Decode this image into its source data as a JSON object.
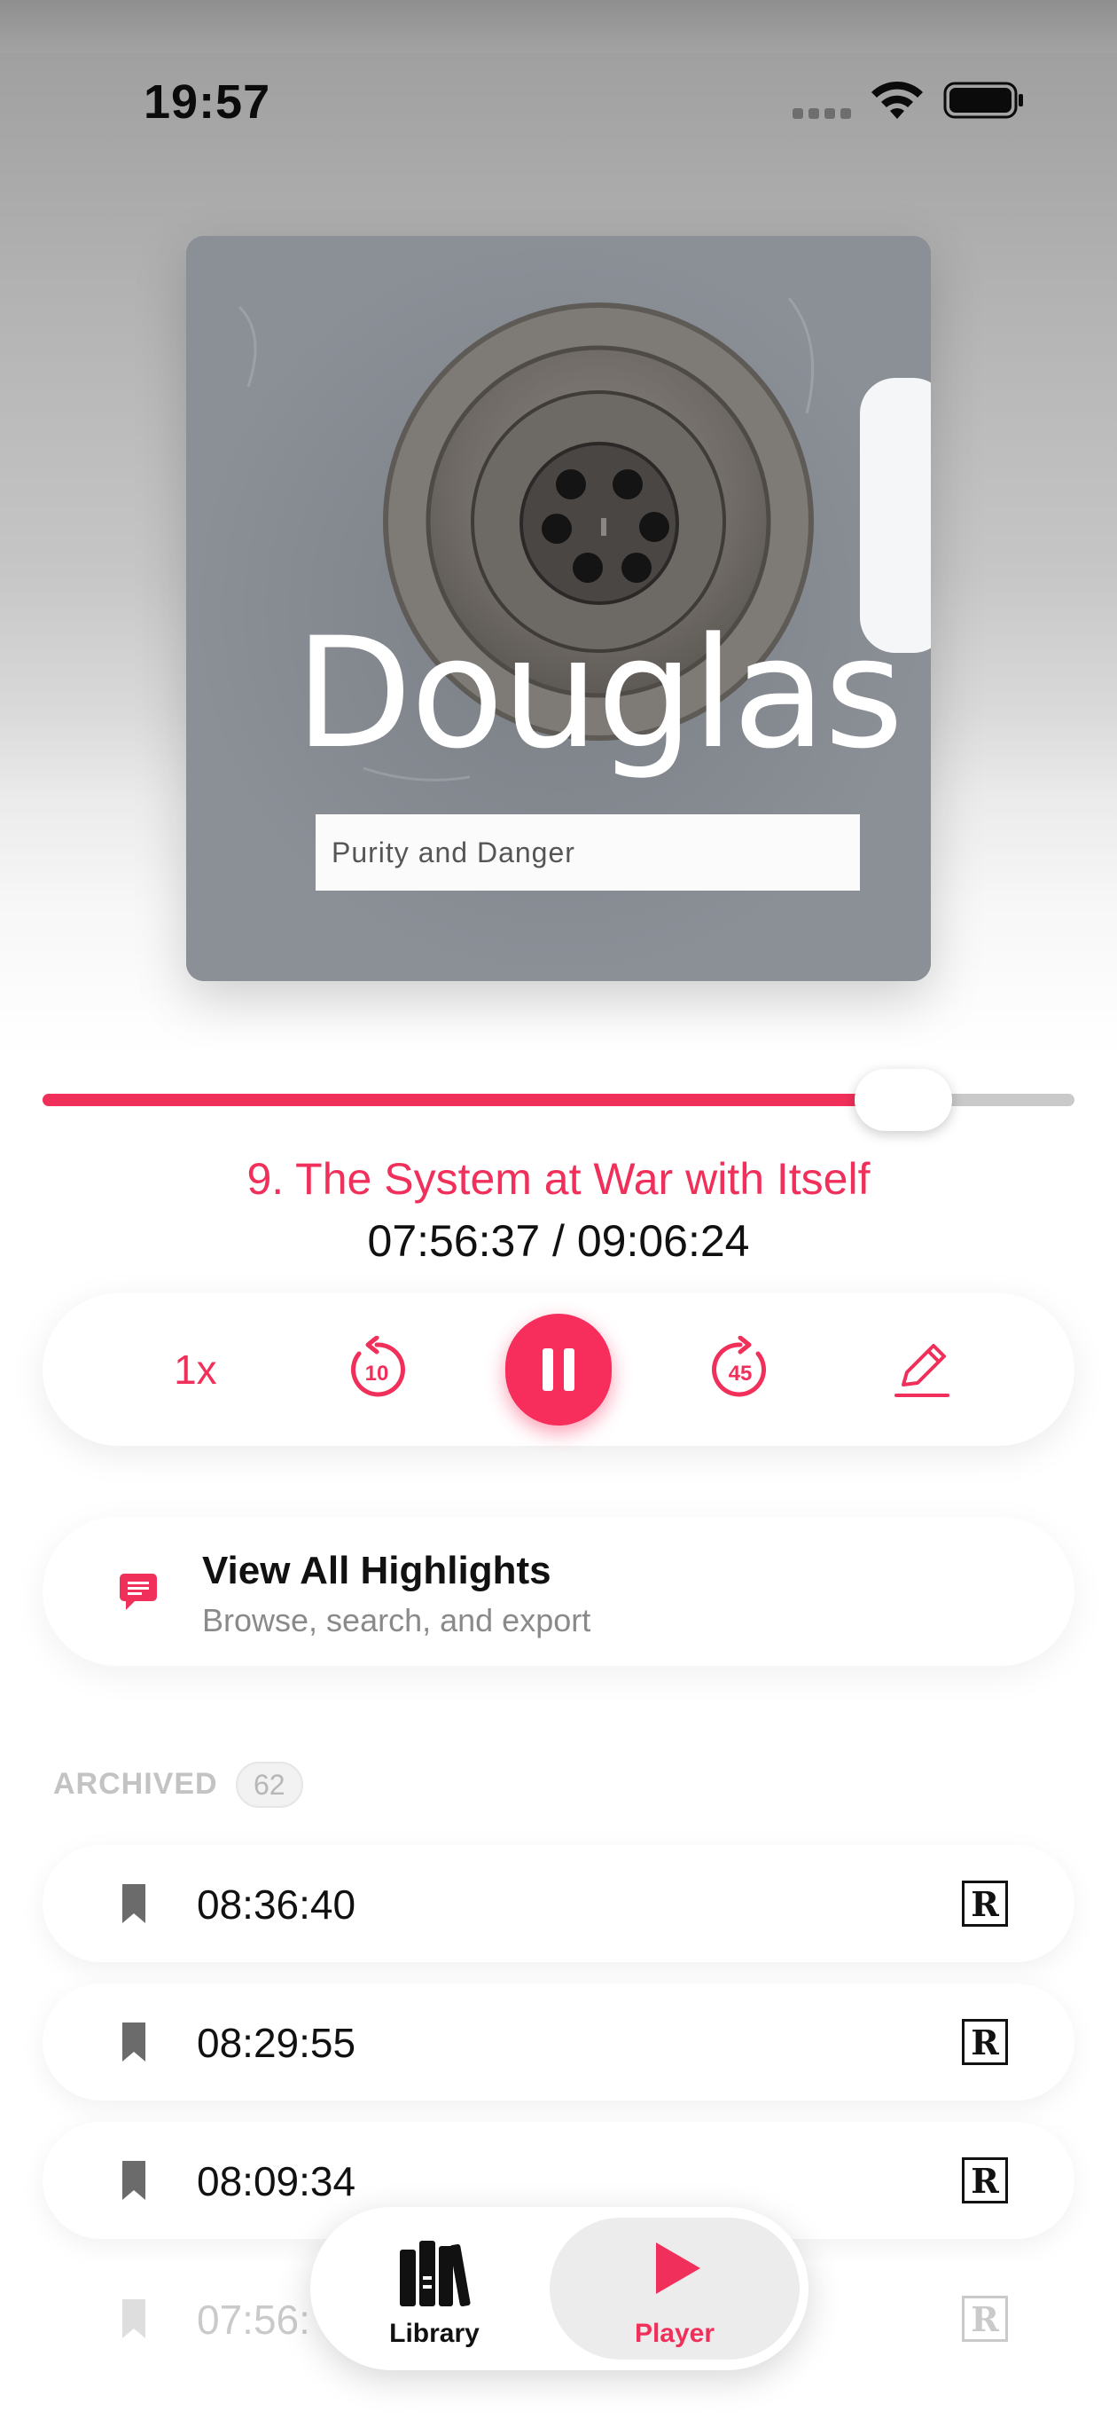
{
  "status_bar": {
    "time": "19:57"
  },
  "album": {
    "cover_author": "Douglas",
    "cover_subtitle": "Purity and Danger"
  },
  "playback": {
    "progress_fraction": 0.834,
    "chapter_title": "9. The System at War with Itself",
    "time_readout": "07:56:37 / 09:06:24",
    "accent_color": "#f0305a"
  },
  "controls": {
    "speed_label": "1x",
    "rewind_icon": "rewind-10-icon",
    "rewind_seconds": "10",
    "play_pause_icon": "pause-icon",
    "forward_icon": "forward-45-icon",
    "forward_seconds": "45",
    "edit_icon": "pencil-icon"
  },
  "highlights": {
    "title": "View All Highlights",
    "subtitle": "Browse, search, and export"
  },
  "archived": {
    "label": "ARCHIVED",
    "count": "62",
    "items": [
      {
        "time": "08:36:40",
        "badge": "R"
      },
      {
        "time": "08:29:55",
        "badge": "R"
      },
      {
        "time": "08:09:34",
        "badge": "R"
      },
      {
        "time": "07:56:",
        "badge": "R"
      }
    ]
  },
  "tabbar": {
    "library_label": "Library",
    "player_label": "Player"
  }
}
